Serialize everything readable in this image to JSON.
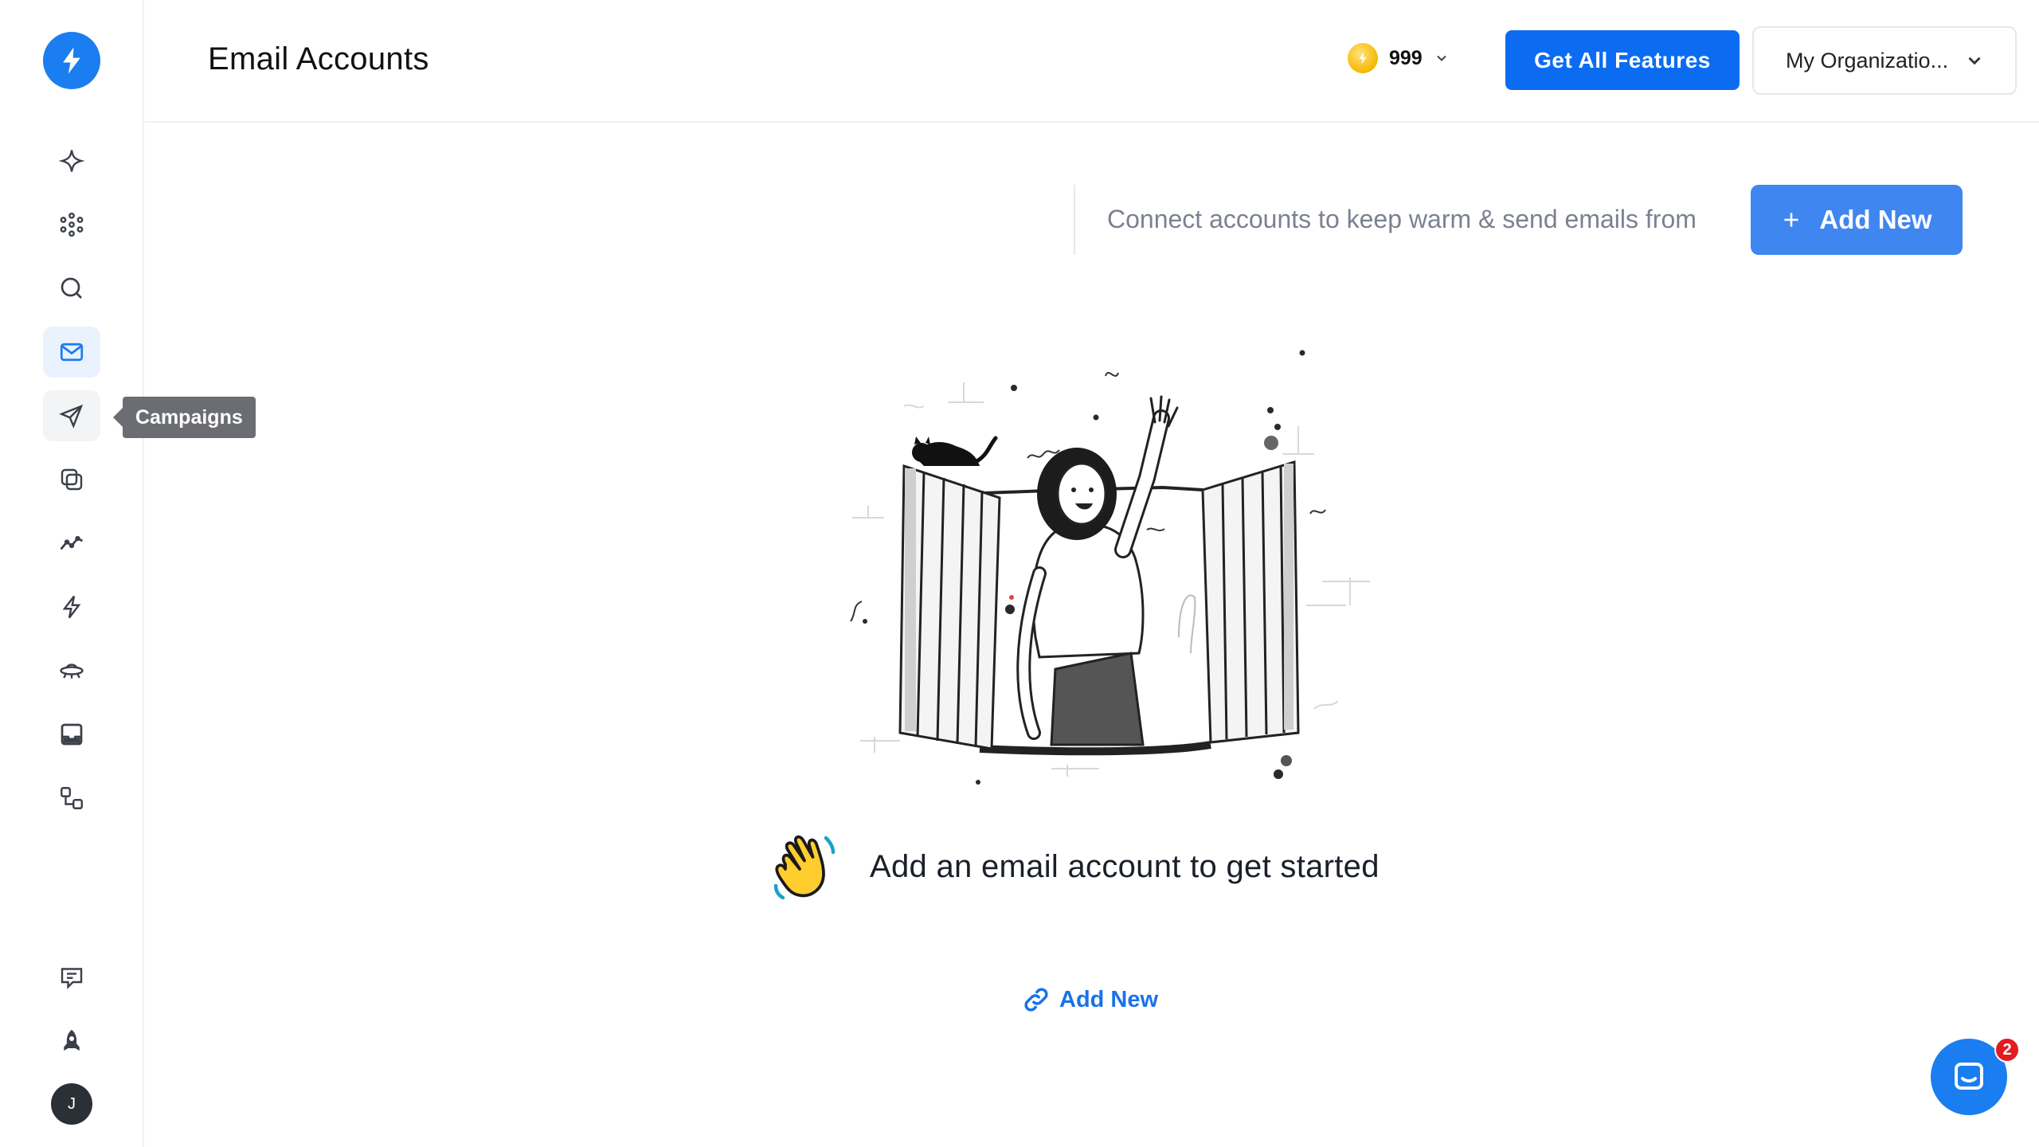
{
  "app": {
    "logo_icon": "bolt-icon",
    "brand_color": "#1a7df0"
  },
  "sidebar": {
    "items": [
      {
        "name": "sparkle-icon"
      },
      {
        "name": "network-icon"
      },
      {
        "name": "search-icon"
      },
      {
        "name": "mail-icon",
        "active": true
      },
      {
        "name": "send-icon",
        "hover": true
      },
      {
        "name": "copy-icon"
      },
      {
        "name": "analytics-icon"
      },
      {
        "name": "bolt-icon"
      },
      {
        "name": "ufo-icon"
      },
      {
        "name": "inbox-icon"
      },
      {
        "name": "workflow-icon"
      }
    ],
    "bottom_items": [
      {
        "name": "feedback-icon"
      },
      {
        "name": "rocket-icon"
      }
    ],
    "avatar_initial": "J",
    "tooltip": "Campaigns"
  },
  "header": {
    "title": "Email Accounts",
    "credits": "999",
    "cta_label": "Get All Features",
    "org_label": "My Organizatio..."
  },
  "toolbar": {
    "hint": "Connect accounts to keep warm & send emails from",
    "add_label": "Add New"
  },
  "empty_state": {
    "emoji": "👋",
    "title": "Add an email account to get started",
    "link_label": "Add New"
  },
  "chat": {
    "badge_count": "2"
  }
}
